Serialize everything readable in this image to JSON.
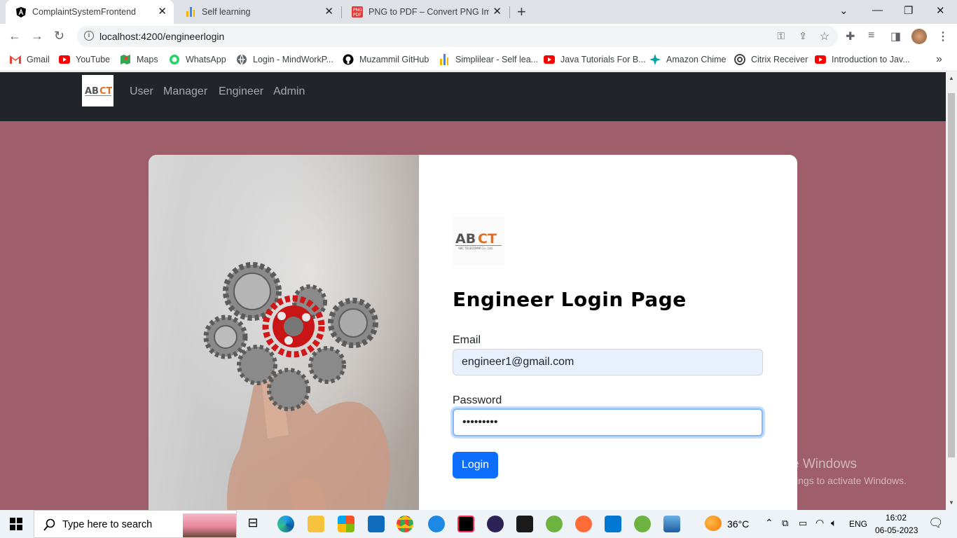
{
  "browser": {
    "tabs": [
      {
        "title": "ComplaintSystemFrontend",
        "icon": "angular-icon",
        "active": true
      },
      {
        "title": "Self learning",
        "icon": "simplilearn-icon",
        "active": false
      },
      {
        "title": "PNG to PDF – Convert PNG Imag",
        "icon": "png-pdf-icon",
        "active": false
      }
    ],
    "new_tab": "+",
    "url": "localhost:4200/engineerlogin"
  },
  "bookmarks": [
    {
      "label": "Gmail",
      "icon": "gmail-icon",
      "color": "#ea4335"
    },
    {
      "label": "YouTube",
      "icon": "youtube-icon",
      "color": "#ff0000"
    },
    {
      "label": "Maps",
      "icon": "maps-icon",
      "color": "#34a853"
    },
    {
      "label": "WhatsApp",
      "icon": "whatsapp-icon",
      "color": "#25d366"
    },
    {
      "label": "Login - MindWorkP...",
      "icon": "globe-icon",
      "color": "#5f6368"
    },
    {
      "label": "Muzammil GitHub",
      "icon": "github-icon",
      "color": "#000000"
    },
    {
      "label": "Simplilear - Self lea...",
      "icon": "simplilearn-icon",
      "color": "#f4b400"
    },
    {
      "label": "Java Tutorials For B...",
      "icon": "youtube-icon",
      "color": "#ff0000"
    },
    {
      "label": "Amazon Chime",
      "icon": "chime-icon",
      "color": "#00a3a3"
    },
    {
      "label": "Citrix Receiver",
      "icon": "citrix-icon",
      "color": "#444444"
    },
    {
      "label": "Introduction to Jav...",
      "icon": "youtube-icon",
      "color": "#ff0000"
    }
  ],
  "navbar": {
    "brand": "ABCT",
    "links": [
      "User",
      "Manager",
      "Engineer",
      "Admin"
    ]
  },
  "logo": {
    "text": "ABCT",
    "subtext": "ABC TELECOMM Co., Ltd."
  },
  "form": {
    "title": "Engineer Login Page",
    "email_label": "Email",
    "email_value": "engineer1@gmail.com",
    "password_label": "Password",
    "password_value": "•••••••••",
    "login_label": "Login"
  },
  "watermark": {
    "line1": "Activate Windows",
    "line2": "Go to Settings to activate Windows."
  },
  "taskbar": {
    "search_placeholder": "Type here to search",
    "weather": "36°C",
    "language": "ENG",
    "time": "16:02",
    "date": "06-05-2023"
  },
  "colors": {
    "page_bg": "#9e5e6c",
    "navbar_bg": "#212529",
    "primary": "#0d6efd",
    "logo_orange": "#e36f1e"
  }
}
